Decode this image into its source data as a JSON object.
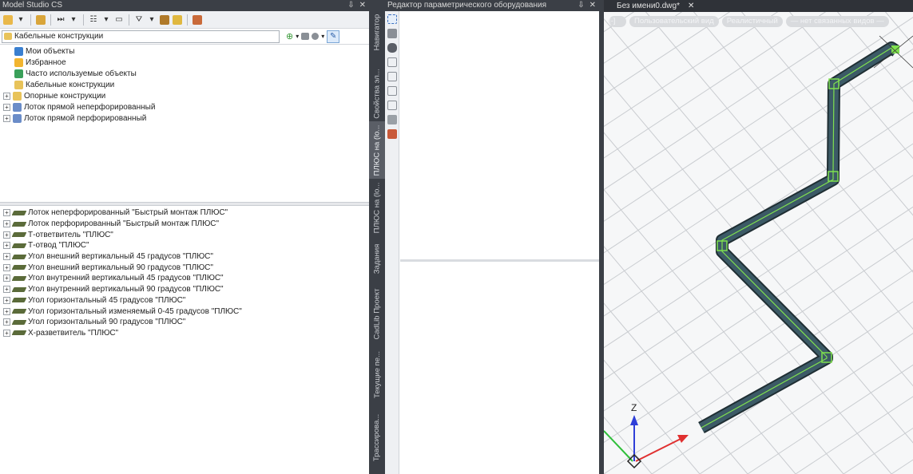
{
  "left_panel": {
    "title": "Model Studio CS",
    "pin_icon": "pin-icon",
    "close_label": "✕",
    "addr": {
      "value": "Кабельные конструкции"
    },
    "tree": [
      {
        "label": "Мои объекты",
        "icon": "my-objects-icon",
        "color": "#3a7fd0",
        "expandable": false
      },
      {
        "label": "Избранное",
        "icon": "star-icon",
        "color": "#f2b530",
        "expandable": false
      },
      {
        "label": "Часто используемые объекты",
        "icon": "frequent-icon",
        "color": "#3aa05a",
        "expandable": false
      },
      {
        "label": "Кабельные конструкции",
        "icon": "folder-icon",
        "color": "#e8c35a",
        "expandable": false
      },
      {
        "label": "Опорные конструкции",
        "icon": "folder-icon",
        "color": "#e8c35a",
        "expandable": true
      },
      {
        "label": "Лоток прямой неперфорированный",
        "icon": "catalog-icon",
        "color": "#6a8cc8",
        "expandable": true
      },
      {
        "label": "Лоток прямой перфорированный",
        "icon": "catalog-icon",
        "color": "#6a8cc8",
        "expandable": true
      }
    ],
    "list": [
      "Лоток неперфорированный \"Быстрый монтаж ПЛЮС\"",
      "Лоток перфорированный \"Быстрый монтаж ПЛЮС\"",
      "Т-ответвитель \"ПЛЮС\"",
      "Т-отвод \"ПЛЮС\"",
      "Угол внешний вертикальный 45 градусов \"ПЛЮС\"",
      "Угол внешний вертикальный 90 градусов \"ПЛЮС\"",
      "Угол внутренний вертикальный 45 градусов \"ПЛЮС\"",
      "Угол внутренний вертикальный 90 градусов \"ПЛЮС\"",
      "Угол горизонтальный 45 градусов \"ПЛЮС\"",
      "Угол горизонтальный изменяемый 0-45 градусов \"ПЛЮС\"",
      "Угол горизонтальный 90 градусов \"ПЛЮС\"",
      "Х-разветвитель \"ПЛЮС\""
    ]
  },
  "vertical_tabs": [
    {
      "label": "Навигатор",
      "active": false
    },
    {
      "label": "Свойства эл...",
      "active": false
    },
    {
      "label": "ПЛЮС на (lo...",
      "active": true
    },
    {
      "label": "ПЛЮС на (lo...",
      "active": false
    },
    {
      "label": "Задания",
      "active": false
    },
    {
      "label": "CadLib Проект",
      "active": false
    },
    {
      "label": "Текущие пе...",
      "active": false
    },
    {
      "label": "Трассирова...",
      "active": false
    }
  ],
  "middle_panel": {
    "title": "Редактор параметрического оборудования",
    "close_label": "✕"
  },
  "viewport": {
    "tab_label": "Без имени0.dwg*",
    "tab_close": "✕",
    "chips": [
      "[-]",
      "Пользовательский вид",
      "Реалистичный",
      "— нет связанных видов —"
    ],
    "axis_label_z": "Z",
    "colors": {
      "grid": "#c9ccd0",
      "tray_fill": "#3c5a66",
      "tray_edge": "#1f2e33",
      "tray_line": "#7fe14f",
      "axis_x": "#e03030",
      "axis_y": "#2fbf3a",
      "axis_z": "#2f3fd8"
    }
  }
}
